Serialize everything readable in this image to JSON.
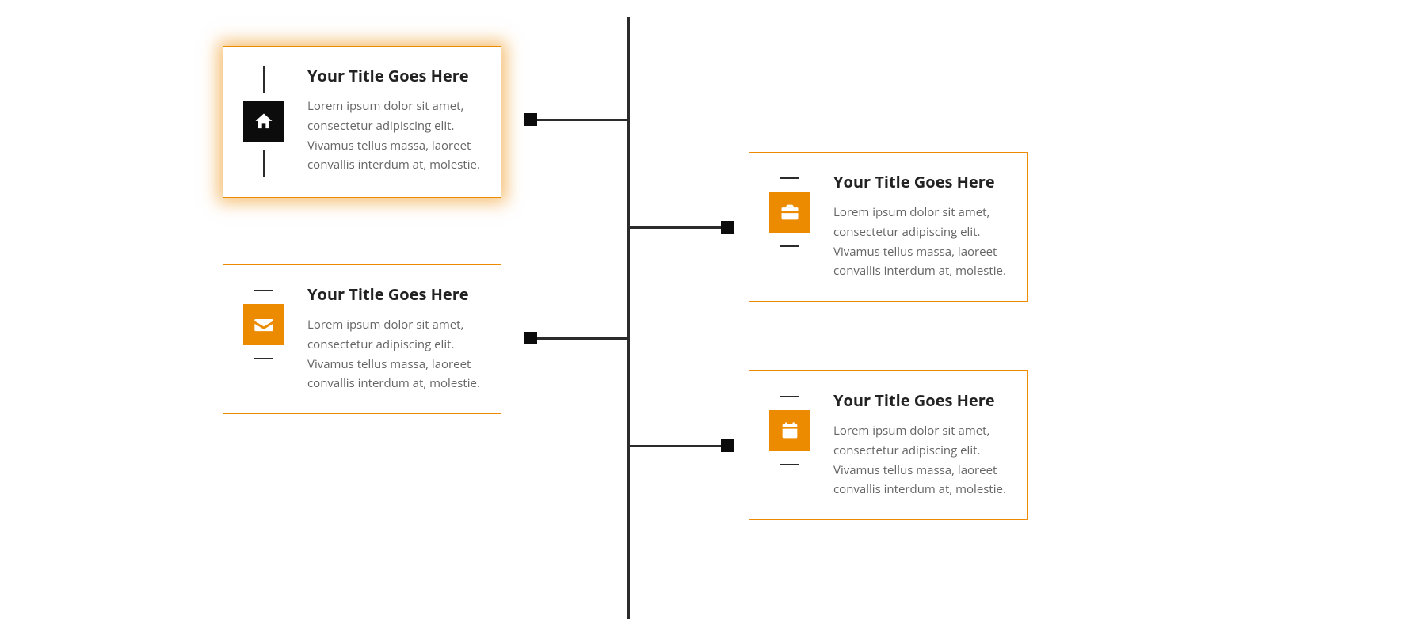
{
  "colors": {
    "accent": "#ed8b00",
    "ink": "#222222",
    "icon_black": "#0c0c0c",
    "muted": "#666666"
  },
  "timeline": {
    "items": [
      {
        "title": "Your Title Goes Here",
        "body": "Lorem ipsum dolor sit amet, consectetur adipiscing elit. Vivamus tellus massa, laoreet convallis interdum at, molestie.",
        "icon": "home-icon",
        "side": "left",
        "active": true,
        "icon_style": "black"
      },
      {
        "title": "Your Title Goes Here",
        "body": "Lorem ipsum dolor sit amet, consectetur adipiscing elit. Vivamus tellus massa, laoreet convallis interdum at, molestie.",
        "icon": "briefcase-icon",
        "side": "right",
        "active": false,
        "icon_style": "orange"
      },
      {
        "title": "Your Title Goes Here",
        "body": "Lorem ipsum dolor sit amet, consectetur adipiscing elit. Vivamus tellus massa, laoreet convallis interdum at, molestie.",
        "icon": "envelope-icon",
        "side": "left",
        "active": false,
        "icon_style": "orange"
      },
      {
        "title": "Your Title Goes Here",
        "body": "Lorem ipsum dolor sit amet, consectetur adipiscing elit. Vivamus tellus massa, laoreet convallis interdum at, molestie.",
        "icon": "calendar-icon",
        "side": "right",
        "active": false,
        "icon_style": "orange"
      }
    ]
  }
}
